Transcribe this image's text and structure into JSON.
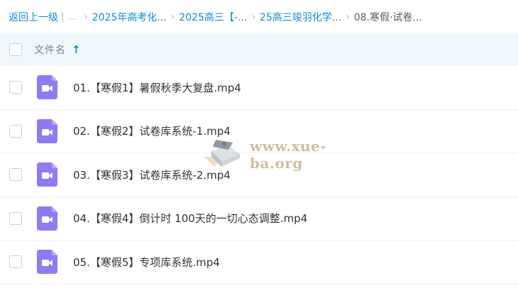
{
  "breadcrumb": {
    "back": "返回上一级",
    "divider": "|",
    "ellipsis": "...",
    "items": [
      "2025年高考化...",
      "2025高三【-...",
      "25高三竣羽化学...",
      "08.寒假·试卷..."
    ]
  },
  "table_header": {
    "name_label": "文件名",
    "sort_icon": "arrow-up-icon"
  },
  "files": [
    {
      "name": "01.【寒假1】暑假秋季大复盘.mp4",
      "icon": "video-file-icon"
    },
    {
      "name": "02.【寒假2】试卷库系统-1.mp4",
      "icon": "video-file-icon"
    },
    {
      "name": "03.【寒假3】试卷库系统-2.mp4",
      "icon": "video-file-icon"
    },
    {
      "name": "04.【寒假4】倒计时 100天的一切心态调整.mp4",
      "icon": "video-file-icon"
    },
    {
      "name": "05.【寒假5】专项库系统.mp4",
      "icon": "video-file-icon"
    }
  ],
  "watermark": {
    "text": "www.xue-ba.org"
  },
  "colors": {
    "accent": "#0a8bd8",
    "header_bg": "#f1f8fd",
    "file_icon": "#8b7cf6"
  }
}
